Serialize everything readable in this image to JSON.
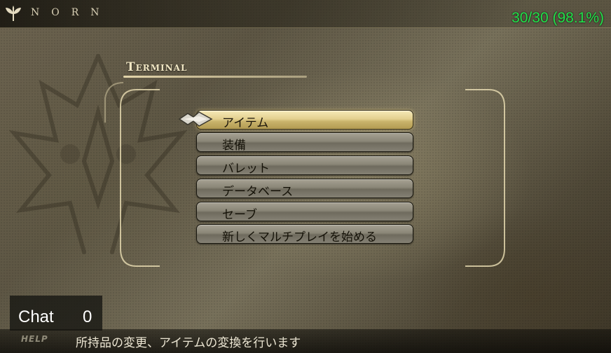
{
  "header": {
    "logo_text": "NORN",
    "performance": "30/30 (98.1%)"
  },
  "terminal": {
    "title": "Terminal"
  },
  "menu": {
    "selected_index": 0,
    "items": [
      {
        "label": "アイテム"
      },
      {
        "label": "装備"
      },
      {
        "label": "バレット"
      },
      {
        "label": "データベース"
      },
      {
        "label": "セーブ"
      },
      {
        "label": "新しくマルチプレイを始める"
      }
    ]
  },
  "chat": {
    "label": "Chat",
    "count": "0"
  },
  "help": {
    "tag": "HELP",
    "text": "所持品の変更、アイテムの変換を行います"
  },
  "colors": {
    "performance_text": "#22e04a",
    "selected_item": "#e3d08f",
    "unselected_item": "#8a8677"
  }
}
